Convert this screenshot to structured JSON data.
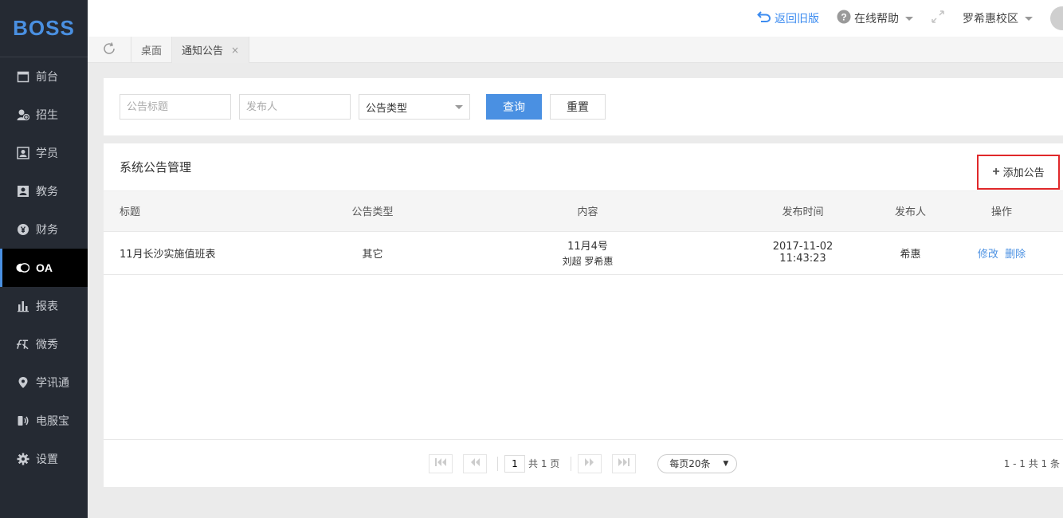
{
  "logo": "BOSS",
  "sidebar": {
    "items": [
      {
        "label": "前台"
      },
      {
        "label": "招生"
      },
      {
        "label": "学员"
      },
      {
        "label": "教务"
      },
      {
        "label": "财务"
      },
      {
        "label": "OA"
      },
      {
        "label": "报表"
      },
      {
        "label": "微秀"
      },
      {
        "label": "学讯通"
      },
      {
        "label": "电服宝"
      },
      {
        "label": "设置"
      }
    ],
    "active_index": 5
  },
  "topbar": {
    "back_label": "返回旧版",
    "help_label": "在线帮助",
    "campus_label": "罗希惠校区"
  },
  "tabs": [
    {
      "label": "桌面"
    },
    {
      "label": "通知公告",
      "close": "×"
    }
  ],
  "filter": {
    "title_placeholder": "公告标题",
    "publisher_placeholder": "发布人",
    "type_select": "公告类型",
    "query_label": "查询",
    "reset_label": "重置"
  },
  "card": {
    "title": "系统公告管理",
    "add_label": "添加公告"
  },
  "table": {
    "headers": [
      "标题",
      "公告类型",
      "内容",
      "发布时间",
      "发布人",
      "操作"
    ],
    "rows": [
      {
        "title": "11月长沙实施值班表",
        "type": "其它",
        "content_line1": "11月4号",
        "content_line2": "刘超  罗希惠",
        "date": "2017-11-02",
        "time": "11:43:23",
        "publisher": "希惠",
        "edit_label": "修改",
        "delete_label": "删除"
      }
    ]
  },
  "pager": {
    "current_page": "1",
    "total_pages_text": "共 1 页",
    "per_page": "每页20条",
    "range_text": "1 - 1  共 1 条"
  },
  "colors": {
    "accent": "#4a90e2",
    "sidebar_bg": "#252a33",
    "highlight_border": "#e0282a"
  }
}
